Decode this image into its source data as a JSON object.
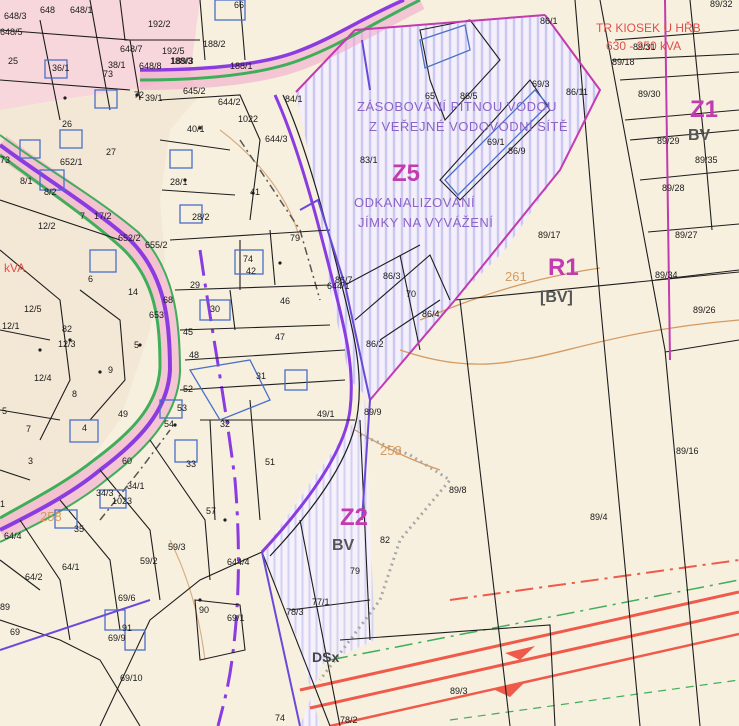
{
  "zones": [
    {
      "code": "Z1",
      "use": "BV"
    },
    {
      "code": "Z2",
      "use": "BV"
    },
    {
      "code": "Z5",
      "use": ""
    },
    {
      "code": "R1",
      "use": "[BV]"
    }
  ],
  "dsx_label": "DSx",
  "notes": [
    "ZÁSOBOVÁNÍ PITNOU VODOU",
    "Z VEŘEJNÉ VODOVODNÍ SÍTĚ",
    "ODKANALIZOVÁNÍ",
    "JÍMKY NA VYVÁŽENÍ"
  ],
  "transformer": [
    "TR KIOSEK U HŘB",
    "630 - 250 kVA"
  ],
  "left_kva": "kVA",
  "contours": [
    "261",
    "258",
    "258"
  ],
  "colors": {
    "zone_magenta": "#c23bb0",
    "road_purple": "#8a3ce0",
    "road_green": "#3fae5a",
    "power_red": "#ef5a4a",
    "parcel_line": "#1e1e1e",
    "hatch_blue": "#c9c9ef",
    "background": "#f7f0df",
    "built_pink": "#f6d4dc"
  },
  "parcels": [
    "648/3",
    "648",
    "648/1",
    "648/5",
    "25",
    "36/1",
    "648/7",
    "192/2",
    "192/5",
    "188/2",
    "188/3",
    "188/1",
    "66",
    "38/1",
    "73",
    "648/8",
    "189/3",
    "645/2",
    "644/2",
    "1022",
    "84/1",
    "644/3",
    "40/1",
    "39/1",
    "72",
    "26",
    "27",
    "652/1",
    "28/1",
    "41",
    "28/2",
    "79",
    "74",
    "42",
    "86/7",
    "644/1",
    "86/3",
    "70",
    "86/4",
    "86/2",
    "29",
    "46",
    "30",
    "47",
    "48",
    "45",
    "653",
    "31",
    "49/1",
    "52",
    "53",
    "54",
    "32",
    "33",
    "51",
    "89/9",
    "60",
    "34/1",
    "34/3",
    "1023",
    "57",
    "35",
    "59/3",
    "59/2",
    "64/1",
    "64/2",
    "64/4",
    "644/4",
    "69/6",
    "91",
    "90",
    "69/9",
    "69/1",
    "69/10",
    "77/1",
    "78/3",
    "79",
    "82",
    "74",
    "78/2",
    "86/1",
    "89/32",
    "89/31",
    "89/18",
    "86/5",
    "65",
    "69/3",
    "86/11",
    "69/1",
    "86/9",
    "83/1",
    "89/30",
    "89/29",
    "89/35",
    "89/28",
    "89/17",
    "89/27",
    "89/34",
    "89/26",
    "89/16",
    "89/8",
    "89/4",
    "89/3",
    "8/1",
    "8/2",
    "7",
    "17/2",
    "12/2",
    "652/2",
    "655/2",
    "6",
    "14",
    "68",
    "12/5",
    "12/1",
    "82",
    "12/3",
    "5",
    "9",
    "12/4",
    "8",
    "49",
    "4",
    "7",
    "3",
    "1",
    "5",
    "73",
    "89",
    "69"
  ]
}
